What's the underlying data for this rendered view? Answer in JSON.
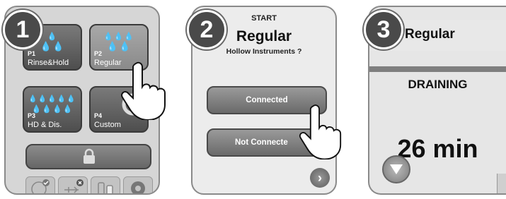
{
  "steps": [
    "1",
    "2",
    "3"
  ],
  "panel1": {
    "tiles": [
      {
        "num": "P1",
        "name": "Rinse&Hold",
        "icon": "water-drops-icon"
      },
      {
        "num": "P2",
        "name": "Regular",
        "icon": "water-drops-icon"
      },
      {
        "num": "P3",
        "name": "HD & Dis.",
        "icon": "water-drops-icon"
      },
      {
        "num": "P4",
        "name": "Custom",
        "icon": "custom-ring-icon"
      }
    ],
    "lock_icon": "lock-icon",
    "bottom_icons": [
      "globe-check-icon",
      "usb-error-icon",
      "bottles-icon",
      "gear-info-icon"
    ]
  },
  "panel2": {
    "header": "START",
    "title": "Regular",
    "subtitle": "Hollow Instruments ?",
    "buttons": {
      "connected": "Connected",
      "not_connected": "Not Connecte"
    },
    "next_icon": "chevron-right-icon"
  },
  "panel3": {
    "title": "Regular",
    "status": "DRAINING",
    "time": "26 min",
    "stop_icon": "down-triangle-icon"
  }
}
